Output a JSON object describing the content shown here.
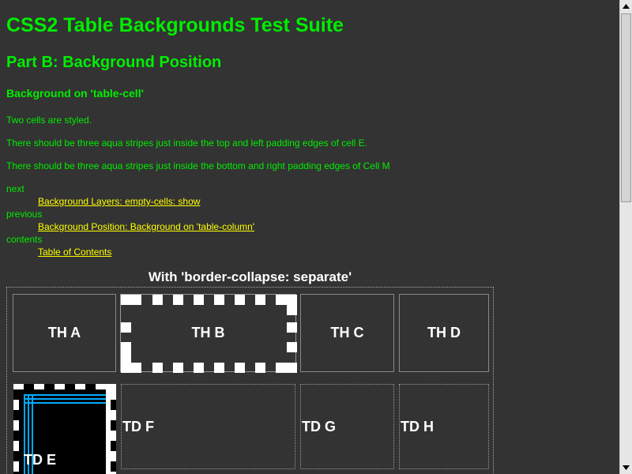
{
  "page": {
    "title": "CSS2 Table Backgrounds Test Suite",
    "subtitle": "Part B: Background Position",
    "section": "Background on 'table-cell'"
  },
  "paragraphs": [
    "Two cells are styled.",
    "There should be three aqua stripes just inside the top and left padding edges of cell E.",
    "There should be three aqua stripes just inside the bottom and right padding edges of Cell M"
  ],
  "nav": {
    "next_label": "next",
    "next_link": "Background Layers: empty-cells: show",
    "previous_label": "previous",
    "previous_link": "Background Position: Background on 'table-column'",
    "contents_label": "contents",
    "contents_link": "Table of Contents"
  },
  "table": {
    "caption": "With 'border-collapse: separate'",
    "header_cells": [
      "TH A",
      "TH B",
      "TH C",
      "TH D"
    ],
    "data_cells": [
      "TD E",
      "TD F",
      "TD G",
      "TD H"
    ]
  },
  "colors": {
    "background": "#333333",
    "text": "#00ee00",
    "link": "#ffff00",
    "cell_text": "#ffffff",
    "stripe": "#00ffff"
  },
  "icons": {
    "scroll_up": "arrow-up-icon",
    "scroll_down": "arrow-down-icon"
  }
}
